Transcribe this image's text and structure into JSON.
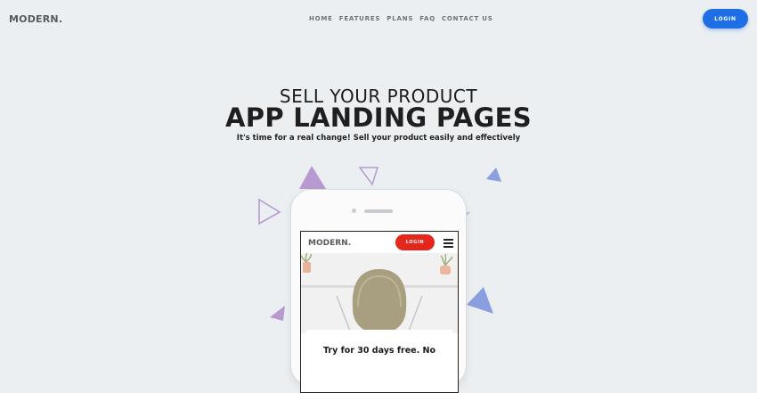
{
  "header": {
    "logo": "MODERN.",
    "nav": [
      "HOME",
      "FEATURES",
      "PLANS",
      "FAQ",
      "CONTACT US"
    ],
    "login_label": "LOGIN"
  },
  "hero": {
    "subtitle": "SELL YOUR PRODUCT",
    "title": "APP LANDING PAGES",
    "description": "It's time for a real change! Sell your product easily and effectively"
  },
  "phone": {
    "logo": "MODERN.",
    "login_label": "LOGIN",
    "card_text": "Try for 30 days free. No"
  },
  "colors": {
    "background": "#eceff1",
    "primary_button": "#1e6fe6",
    "phone_login_button": "#e5271b",
    "triangle_purple": "#b69ad0",
    "triangle_blue": "#8a9fe0"
  },
  "icons": [
    "hamburger-menu-icon"
  ]
}
